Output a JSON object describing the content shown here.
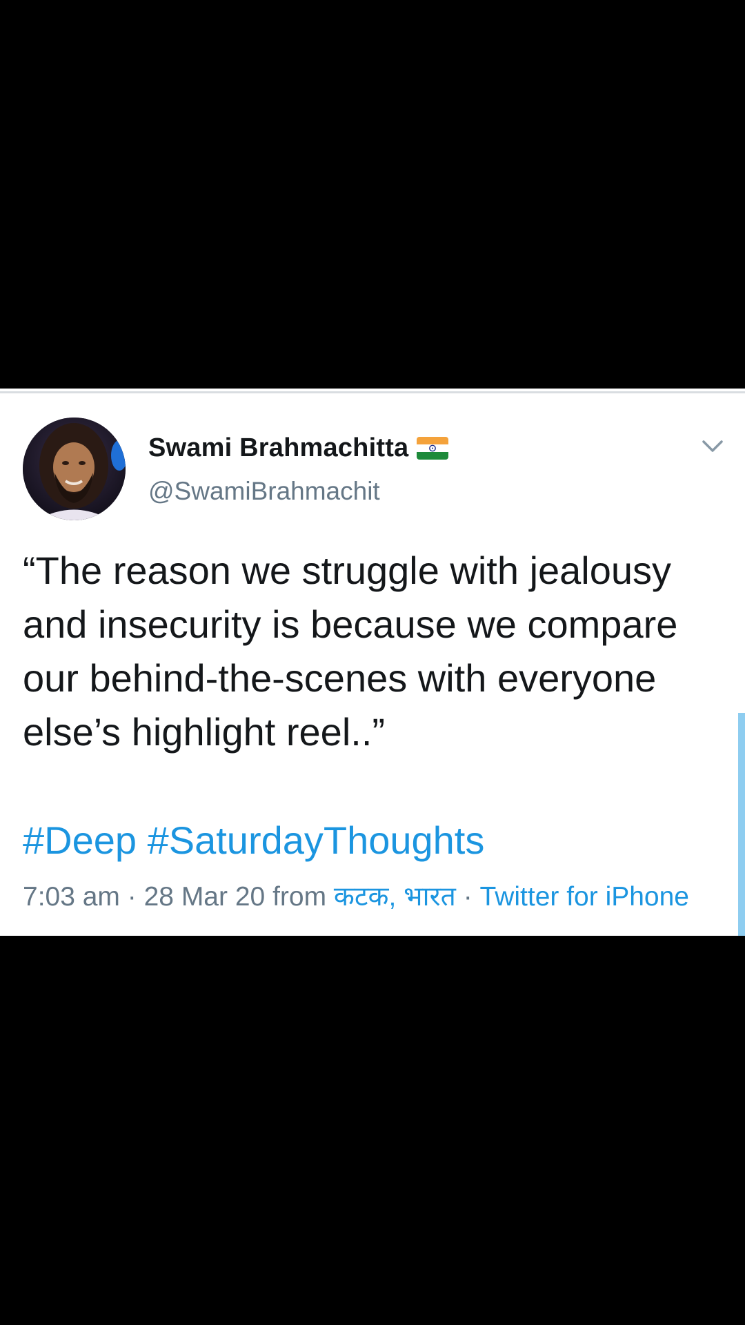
{
  "tweet": {
    "author_name": "Swami Brahmachitta",
    "handle": "@SwamiBrahmachit",
    "text": "“The reason we struggle with jealousy and insecurity is because we compare our behind-the-scenes with everyone else’s highlight reel..”",
    "hashtags": [
      "#Deep",
      "#SaturdayThoughts"
    ],
    "time": "7:03 am",
    "separator": "·",
    "date": "28 Mar 20",
    "from_label": "from",
    "location": "कटक, भारत",
    "source": "Twitter for iPhone"
  },
  "icons": {
    "flag": "india-flag-icon",
    "menu": "chevron-down-icon"
  },
  "colors": {
    "link": "#1b95e0",
    "secondary_text": "#657786",
    "primary_text": "#14171a",
    "scroll_indicator": "#8ecdf0",
    "background": "#000000"
  }
}
